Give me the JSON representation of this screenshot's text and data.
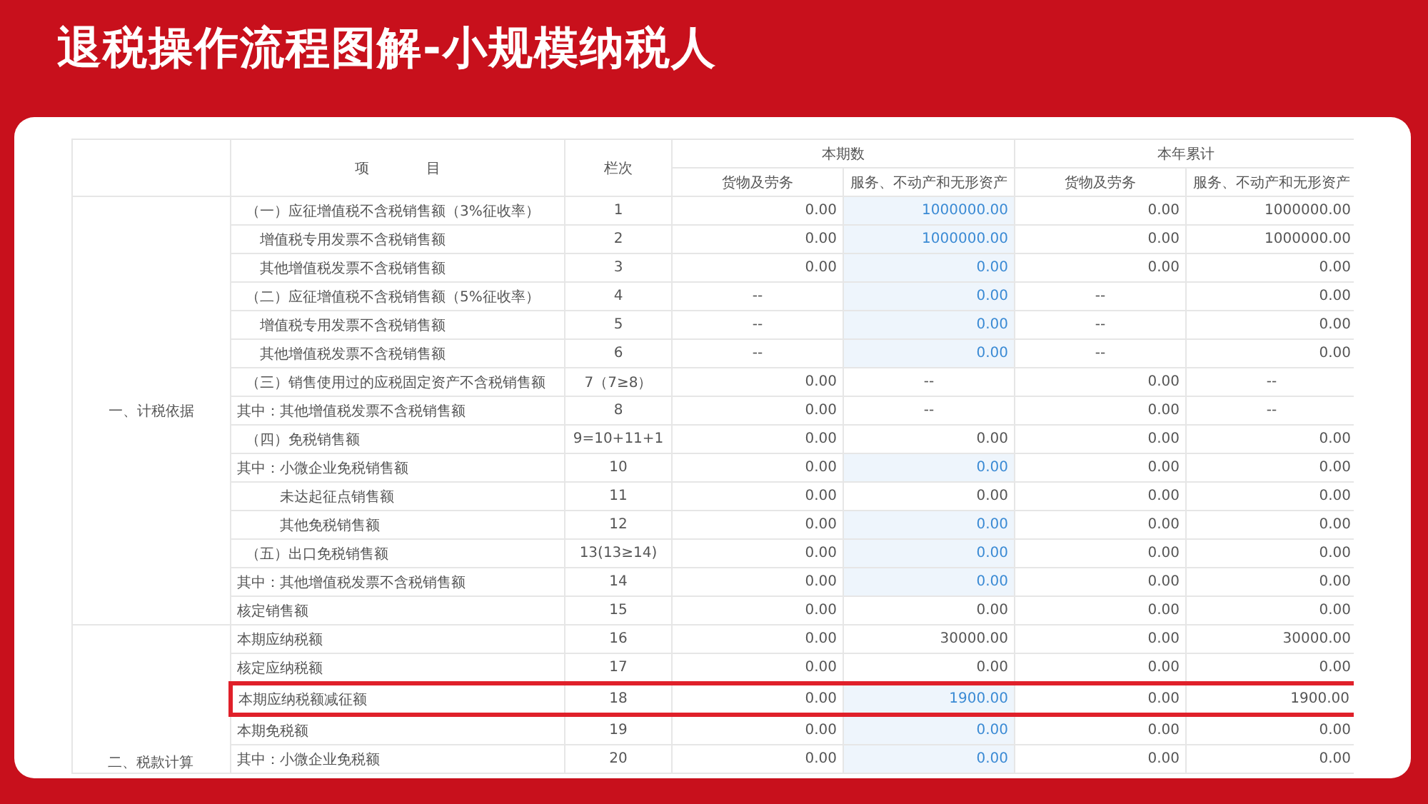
{
  "slide_title": "退税操作流程图解-小规模纳税人",
  "table": {
    "header": {
      "item": "项　　　　目",
      "code": "栏次",
      "groups": [
        {
          "label": "本期数",
          "columns": [
            "货物及劳务",
            "服务、不动产和无形资产"
          ]
        },
        {
          "label": "本年累计",
          "columns": [
            "货物及劳务",
            "服务、不动产和无形资产"
          ]
        }
      ]
    },
    "sections": [
      {
        "label": "一、计税依据",
        "rows": [
          {
            "item": "（一）应征增值税不含税销售额（3%征收率）",
            "kind": "main",
            "code": "1",
            "values": [
              {
                "text": "0.00",
                "editable": false
              },
              {
                "text": "1000000.00",
                "editable": true
              },
              {
                "text": "0.00",
                "editable": false
              },
              {
                "text": "1000000.00",
                "editable": false
              }
            ],
            "highlighted": false
          },
          {
            "item": "增值税专用发票不含税销售额",
            "kind": "sub",
            "code": "2",
            "values": [
              {
                "text": "0.00",
                "editable": false
              },
              {
                "text": "1000000.00",
                "editable": true
              },
              {
                "text": "0.00",
                "editable": false
              },
              {
                "text": "1000000.00",
                "editable": false
              }
            ],
            "highlighted": false
          },
          {
            "item": "其他增值税发票不含税销售额",
            "kind": "sub",
            "code": "3",
            "values": [
              {
                "text": "0.00",
                "editable": false
              },
              {
                "text": "0.00",
                "editable": true
              },
              {
                "text": "0.00",
                "editable": false
              },
              {
                "text": "0.00",
                "editable": false
              }
            ],
            "highlighted": false
          },
          {
            "item": "（二）应征增值税不含税销售额（5%征收率）",
            "kind": "main",
            "code": "4",
            "values": [
              {
                "text": "--",
                "editable": false
              },
              {
                "text": "0.00",
                "editable": true
              },
              {
                "text": "--",
                "editable": false
              },
              {
                "text": "0.00",
                "editable": false
              }
            ],
            "highlighted": false
          },
          {
            "item": "增值税专用发票不含税销售额",
            "kind": "sub",
            "code": "5",
            "values": [
              {
                "text": "--",
                "editable": false
              },
              {
                "text": "0.00",
                "editable": true
              },
              {
                "text": "--",
                "editable": false
              },
              {
                "text": "0.00",
                "editable": false
              }
            ],
            "highlighted": false
          },
          {
            "item": "其他增值税发票不含税销售额",
            "kind": "sub",
            "code": "6",
            "values": [
              {
                "text": "--",
                "editable": false
              },
              {
                "text": "0.00",
                "editable": true
              },
              {
                "text": "--",
                "editable": false
              },
              {
                "text": "0.00",
                "editable": false
              }
            ],
            "highlighted": false
          },
          {
            "item": "（三）销售使用过的应税固定资产不含税销售额",
            "kind": "main",
            "code": "7（7≥8）",
            "values": [
              {
                "text": "0.00",
                "editable": false
              },
              {
                "text": "--",
                "editable": false
              },
              {
                "text": "0.00",
                "editable": false
              },
              {
                "text": "--",
                "editable": false
              }
            ],
            "highlighted": false
          },
          {
            "item": "其中：其他增值税发票不含税销售额",
            "kind": "plain",
            "code": "8",
            "values": [
              {
                "text": "0.00",
                "editable": false
              },
              {
                "text": "--",
                "editable": false
              },
              {
                "text": "0.00",
                "editable": false
              },
              {
                "text": "--",
                "editable": false
              }
            ],
            "highlighted": false
          },
          {
            "item": "（四）免税销售额",
            "kind": "main",
            "code": "9=10+11+1",
            "values": [
              {
                "text": "0.00",
                "editable": false
              },
              {
                "text": "0.00",
                "editable": false
              },
              {
                "text": "0.00",
                "editable": false
              },
              {
                "text": "0.00",
                "editable": false
              }
            ],
            "highlighted": false
          },
          {
            "item": "其中：小微企业免税销售额",
            "kind": "plain",
            "code": "10",
            "values": [
              {
                "text": "0.00",
                "editable": false
              },
              {
                "text": "0.00",
                "editable": true
              },
              {
                "text": "0.00",
                "editable": false
              },
              {
                "text": "0.00",
                "editable": false
              }
            ],
            "highlighted": false
          },
          {
            "item": "未达起征点销售额",
            "kind": "deep",
            "code": "11",
            "values": [
              {
                "text": "0.00",
                "editable": false
              },
              {
                "text": "0.00",
                "editable": false
              },
              {
                "text": "0.00",
                "editable": false
              },
              {
                "text": "0.00",
                "editable": false
              }
            ],
            "highlighted": false
          },
          {
            "item": "其他免税销售额",
            "kind": "deep",
            "code": "12",
            "values": [
              {
                "text": "0.00",
                "editable": false
              },
              {
                "text": "0.00",
                "editable": true
              },
              {
                "text": "0.00",
                "editable": false
              },
              {
                "text": "0.00",
                "editable": false
              }
            ],
            "highlighted": false
          },
          {
            "item": "（五）出口免税销售额",
            "kind": "main",
            "code": "13(13≥14)",
            "values": [
              {
                "text": "0.00",
                "editable": false
              },
              {
                "text": "0.00",
                "editable": true
              },
              {
                "text": "0.00",
                "editable": false
              },
              {
                "text": "0.00",
                "editable": false
              }
            ],
            "highlighted": false
          },
          {
            "item": "其中：其他增值税发票不含税销售额",
            "kind": "plain",
            "code": "14",
            "values": [
              {
                "text": "0.00",
                "editable": false
              },
              {
                "text": "0.00",
                "editable": true
              },
              {
                "text": "0.00",
                "editable": false
              },
              {
                "text": "0.00",
                "editable": false
              }
            ],
            "highlighted": false
          },
          {
            "item": "核定销售额",
            "kind": "plain",
            "code": "15",
            "values": [
              {
                "text": "0.00",
                "editable": false
              },
              {
                "text": "0.00",
                "editable": false
              },
              {
                "text": "0.00",
                "editable": false
              },
              {
                "text": "0.00",
                "editable": false
              }
            ],
            "highlighted": false
          }
        ]
      },
      {
        "label": "二、税款计算",
        "rows": [
          {
            "item": "本期应纳税额",
            "kind": "plain",
            "code": "16",
            "values": [
              {
                "text": "0.00",
                "editable": false
              },
              {
                "text": "30000.00",
                "editable": false
              },
              {
                "text": "0.00",
                "editable": false
              },
              {
                "text": "30000.00",
                "editable": false
              }
            ],
            "highlighted": false
          },
          {
            "item": "核定应纳税额",
            "kind": "plain",
            "code": "17",
            "values": [
              {
                "text": "0.00",
                "editable": false
              },
              {
                "text": "0.00",
                "editable": false
              },
              {
                "text": "0.00",
                "editable": false
              },
              {
                "text": "0.00",
                "editable": false
              }
            ],
            "highlighted": false
          },
          {
            "item": "本期应纳税额减征额",
            "kind": "plain",
            "code": "18",
            "values": [
              {
                "text": "0.00",
                "editable": false
              },
              {
                "text": "1900.00",
                "editable": true
              },
              {
                "text": "0.00",
                "editable": false
              },
              {
                "text": "1900.00",
                "editable": false
              }
            ],
            "highlighted": true
          },
          {
            "item": "本期免税额",
            "kind": "plain",
            "code": "19",
            "values": [
              {
                "text": "0.00",
                "editable": false
              },
              {
                "text": "0.00",
                "editable": true
              },
              {
                "text": "0.00",
                "editable": false
              },
              {
                "text": "0.00",
                "editable": false
              }
            ],
            "highlighted": false
          },
          {
            "item": "其中：小微企业免税额",
            "kind": "plain",
            "code": "20",
            "values": [
              {
                "text": "0.00",
                "editable": false
              },
              {
                "text": "0.00",
                "editable": true
              },
              {
                "text": "0.00",
                "editable": false
              },
              {
                "text": "0.00",
                "editable": false
              }
            ],
            "highlighted": false
          }
        ]
      }
    ]
  }
}
